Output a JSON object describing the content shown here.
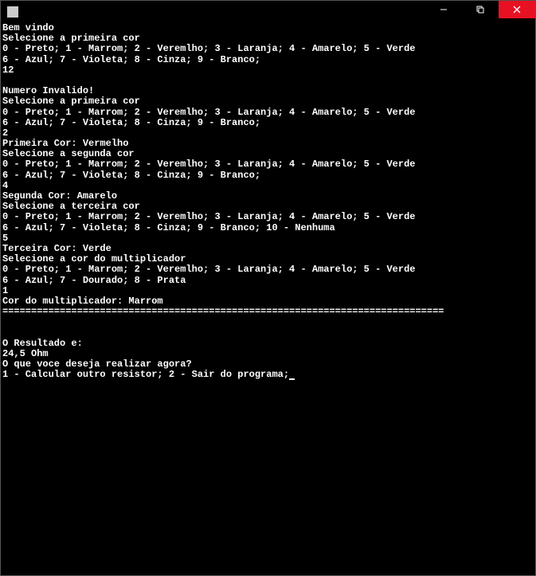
{
  "window": {
    "title_icon": "app-icon"
  },
  "console": {
    "lines": [
      "Bem vindo",
      "Selecione a primeira cor",
      "0 - Preto; 1 - Marrom; 2 - Veremlho; 3 - Laranja; 4 - Amarelo; 5 - Verde",
      "6 - Azul; 7 - Violeta; 8 - Cinza; 9 - Branco;",
      "12",
      "",
      "Numero Invalido!",
      "Selecione a primeira cor",
      "0 - Preto; 1 - Marrom; 2 - Veremlho; 3 - Laranja; 4 - Amarelo; 5 - Verde",
      "6 - Azul; 7 - Violeta; 8 - Cinza; 9 - Branco;",
      "2",
      "Primeira Cor: Vermelho",
      "Selecione a segunda cor",
      "0 - Preto; 1 - Marrom; 2 - Veremlho; 3 - Laranja; 4 - Amarelo; 5 - Verde",
      "6 - Azul; 7 - Violeta; 8 - Cinza; 9 - Branco;",
      "4",
      "Segunda Cor: Amarelo",
      "Selecione a terceira cor",
      "0 - Preto; 1 - Marrom; 2 - Veremlho; 3 - Laranja; 4 - Amarelo; 5 - Verde",
      "6 - Azul; 7 - Violeta; 8 - Cinza; 9 - Branco; 10 - Nenhuma",
      "5",
      "Terceira Cor: Verde",
      "Selecione a cor do multiplicador",
      "0 - Preto; 1 - Marrom; 2 - Veremlho; 3 - Laranja; 4 - Amarelo; 5 - Verde",
      "6 - Azul; 7 - Dourado; 8 - Prata",
      "1",
      "Cor do multiplicador: Marrom",
      "=============================================================================",
      "",
      "",
      "O Resultado e:",
      "24,5 Ohm",
      "O que voce deseja realizar agora?",
      "1 - Calcular outro resistor; 2 - Sair do programa;"
    ]
  }
}
